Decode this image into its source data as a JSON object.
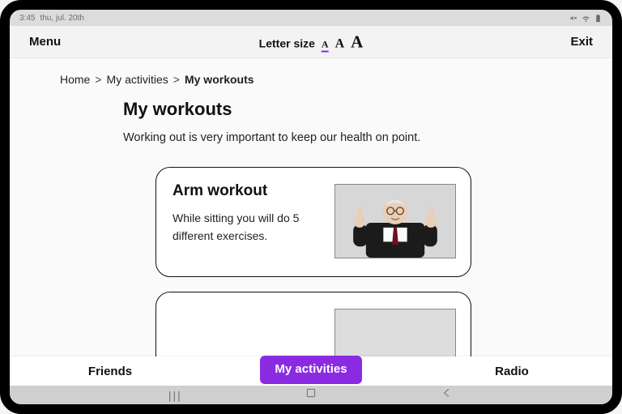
{
  "statusbar": {
    "time": "3:45",
    "date": "thu, jul. 20th"
  },
  "header": {
    "menu": "Menu",
    "exit": "Exit",
    "letter_size_label": "Letter size",
    "sizes": {
      "s": "A",
      "m": "A",
      "l": "A"
    }
  },
  "breadcrumb": {
    "items": [
      {
        "label": "Home"
      },
      {
        "label": "My activities"
      },
      {
        "label": "My workouts"
      }
    ],
    "separator": ">"
  },
  "page": {
    "title": "My workouts",
    "description": "Working out is very important to keep our health on point."
  },
  "cards": [
    {
      "title": "Arm workout",
      "description": "While sitting you will do 5 different exercises.",
      "image_alt": "Older man in suit giving two thumbs up"
    }
  ],
  "tabs": {
    "friends": "Friends",
    "my_activities": "My activities",
    "radio": "Radio"
  },
  "colors": {
    "accent": "#8a2be2"
  }
}
